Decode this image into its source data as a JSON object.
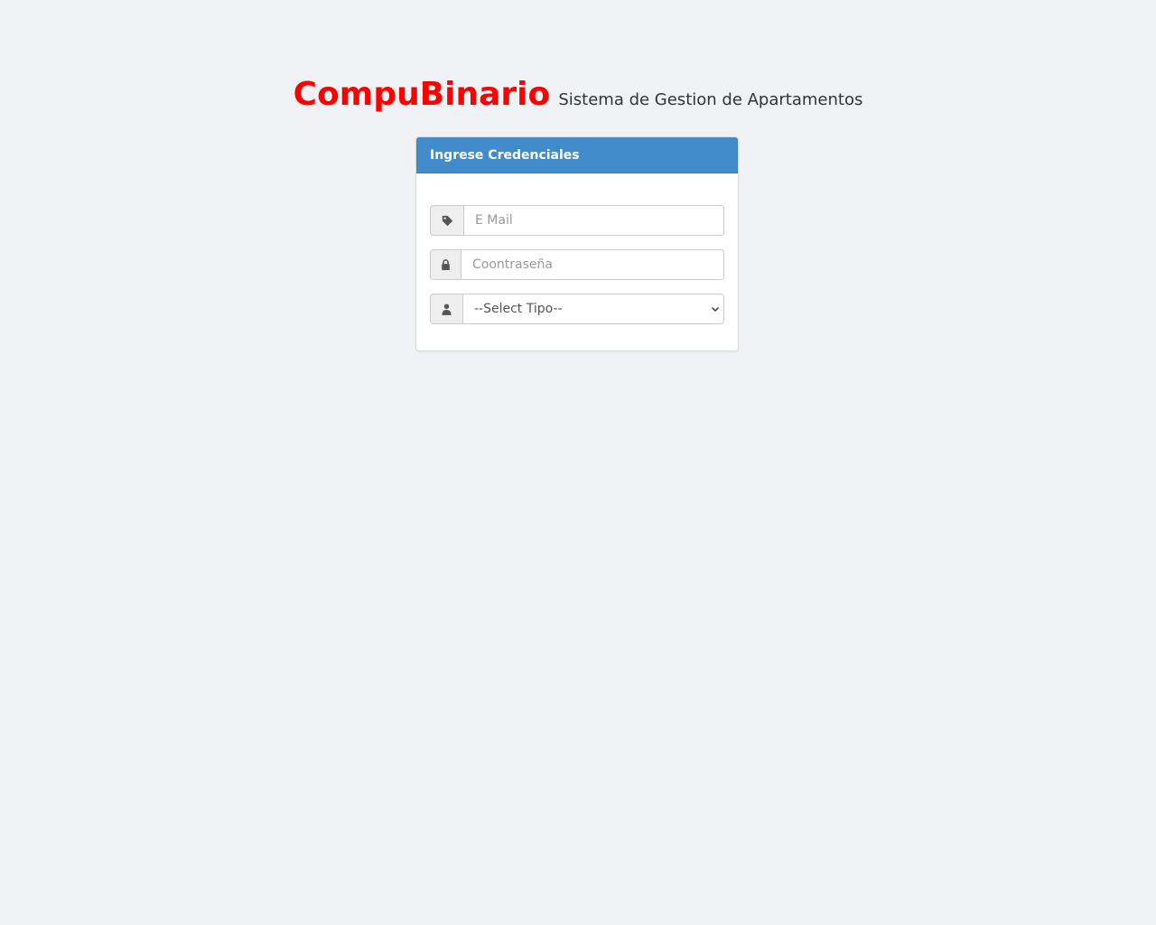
{
  "header": {
    "brand": "CompuBinario",
    "subtitle": "Sistema de Gestion de Apartamentos",
    "brand_color": "#ff0000"
  },
  "login_panel": {
    "title": "Ingrese Credenciales",
    "heading_color": "#428bca",
    "email": {
      "icon": "tag-icon",
      "placeholder": "E Mail",
      "value": ""
    },
    "password": {
      "icon": "lock-icon",
      "placeholder": "Coontraseña",
      "value": ""
    },
    "tipo": {
      "icon": "user-icon",
      "selected": "--Select Tipo--"
    }
  }
}
